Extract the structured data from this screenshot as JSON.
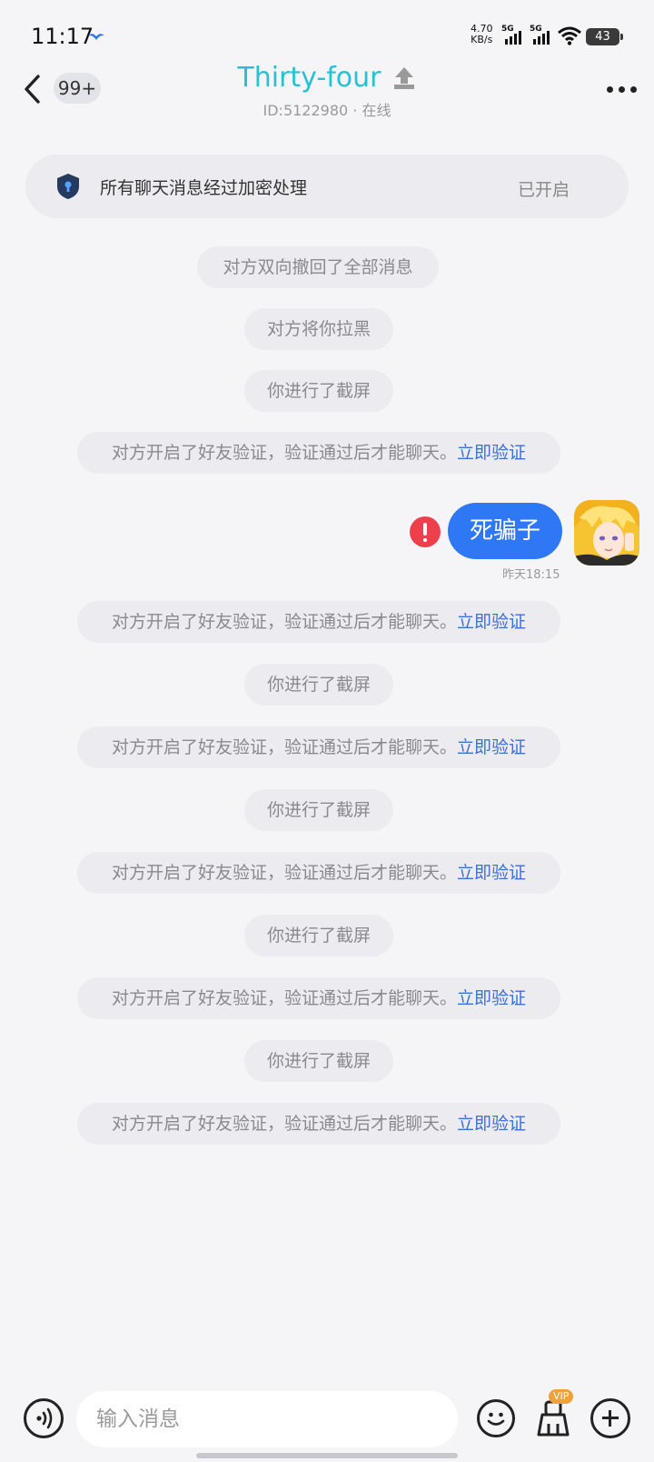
{
  "status_bar": {
    "time": "11:17",
    "net_speed_value": "4.70",
    "net_speed_unit": "KB/s",
    "sim1": "5G",
    "sim2": "5G",
    "battery": "43"
  },
  "header": {
    "unread_badge": "99+",
    "title": "Thirty-four",
    "title_color": "#27c1d6",
    "subtitle": "ID:5122980 · 在线"
  },
  "encryption": {
    "text": "所有聊天消息经过加密处理",
    "status": "已开启"
  },
  "messages": {
    "m0": "对方双向撤回了全部消息",
    "m1": "对方将你拉黑",
    "m2": "你进行了截屏",
    "m3": {
      "text": "对方开启了好友验证，验证通过后才能聊天。",
      "link": "立即验证"
    },
    "outgoing": {
      "text": "死骗子",
      "time": "昨天18:15",
      "bubble_color": "#2f78f5",
      "status_icon": "error-icon"
    },
    "m5": {
      "text": "对方开启了好友验证，验证通过后才能聊天。",
      "link": "立即验证"
    },
    "m6": "你进行了截屏",
    "m7": {
      "text": "对方开启了好友验证，验证通过后才能聊天。",
      "link": "立即验证"
    },
    "m8": "你进行了截屏",
    "m9": {
      "text": "对方开启了好友验证，验证通过后才能聊天。",
      "link": "立即验证"
    },
    "m10": "你进行了截屏",
    "m11": {
      "text": "对方开启了好友验证，验证通过后才能聊天。",
      "link": "立即验证"
    },
    "m12": "你进行了截屏",
    "m13": {
      "text": "对方开启了好友验证，验证通过后才能聊天。",
      "link": "立即验证"
    }
  },
  "input": {
    "placeholder": "输入消息",
    "vip_label": "VIP"
  }
}
